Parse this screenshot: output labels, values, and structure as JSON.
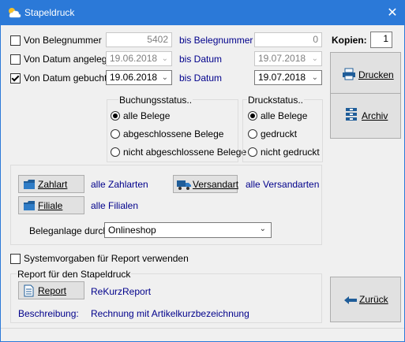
{
  "window": {
    "title": "Stapeldruck",
    "close_label": "✕"
  },
  "filters": {
    "belegnummer": {
      "label": "Von Belegnummer",
      "checked": false,
      "from": "5402",
      "to_label": "bis Belegnummer",
      "to": "0"
    },
    "datum_angelegt": {
      "label": "Von Datum angelegt",
      "checked": false,
      "from": "19.06.2018",
      "to_label": "bis Datum",
      "to": "19.07.2018"
    },
    "datum_gebucht": {
      "label": "Von Datum gebucht",
      "checked": true,
      "from": "19.06.2018",
      "to_label": "bis Datum",
      "to": "19.07.2018"
    }
  },
  "buchungsstatus": {
    "title": "Buchungsstatus..",
    "options": [
      "alle Belege",
      "abgeschlossene Belege",
      "nicht abgeschlossene Belege"
    ],
    "selected": 0
  },
  "druckstatus": {
    "title": "Druckstatus..",
    "options": [
      "alle Belege",
      "gedruckt",
      "nicht gedruckt"
    ],
    "selected": 0
  },
  "buttons": {
    "zahlart": "Zahlart",
    "zahlart_value": "alle Zahlarten",
    "versandart": "Versandart",
    "versandart_value": "alle Versandarten",
    "filiale": "Filiale",
    "filiale_value": "alle Filialen"
  },
  "beleganlage": {
    "label": "Beleganlage durch..",
    "value": "Onlineshop"
  },
  "systemvorgaben": {
    "label": "Systemvorgaben für Report verwenden",
    "checked": false
  },
  "report": {
    "title": "Report für den Stapeldruck",
    "button": "Report",
    "value": "ReKurzReport",
    "desc_label": "Beschreibung:",
    "desc_value": "Rechnung mit Artikelkurzbezeichnung"
  },
  "right": {
    "kopien_label": "Kopien:",
    "kopien_value": "1",
    "drucken": "Drucken",
    "archiv": "Archiv",
    "zurueck": "Zurück"
  }
}
